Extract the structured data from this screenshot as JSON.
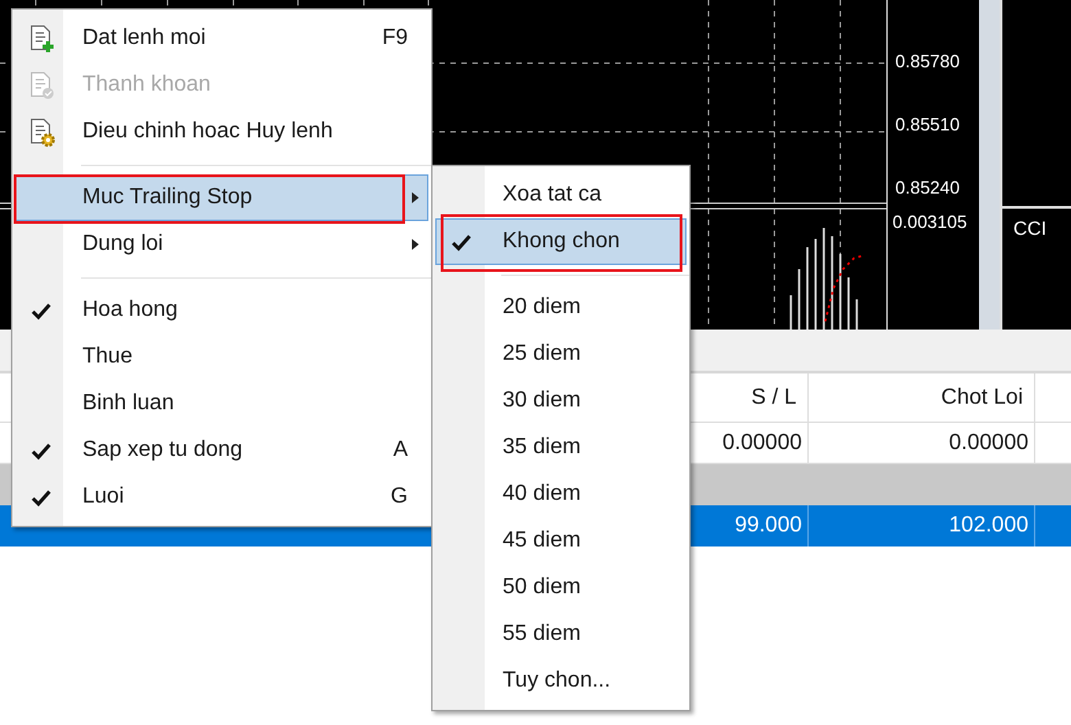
{
  "chart": {
    "price_labels": [
      "0.85780",
      "0.85510",
      "0.85240"
    ],
    "indicator_value": "0.003105",
    "side_label": "CCI"
  },
  "table": {
    "columns": [
      {
        "label": "S / L"
      },
      {
        "label": "Chot Loi"
      }
    ],
    "rows": [
      {
        "kind": "data",
        "selected": false,
        "cells": [
          "0.00000",
          "0.00000"
        ]
      },
      {
        "kind": "group"
      },
      {
        "kind": "data",
        "selected": true,
        "cells": [
          "99.000",
          "102.000"
        ]
      }
    ]
  },
  "context_menu": {
    "items": [
      {
        "kind": "icon-item",
        "label": "Dat lenh moi",
        "shortcut": "F9",
        "disabled": false,
        "checked": false,
        "selected": false,
        "has_submenu": false,
        "annotated": false
      },
      {
        "kind": "icon-item",
        "label": "Thanh khoan",
        "disabled": true,
        "checked": false,
        "selected": false,
        "has_submenu": false,
        "annotated": false
      },
      {
        "kind": "icon-item",
        "label": "Dieu chinh hoac Huy lenh",
        "disabled": false,
        "checked": false,
        "selected": false,
        "has_submenu": false,
        "annotated": false
      },
      {
        "kind": "separator"
      },
      {
        "kind": "item",
        "label": "Muc Trailing Stop",
        "disabled": false,
        "checked": false,
        "selected": true,
        "has_submenu": true,
        "annotated": true
      },
      {
        "kind": "item",
        "label": "Dung loi",
        "disabled": false,
        "checked": false,
        "selected": false,
        "has_submenu": true,
        "annotated": false
      },
      {
        "kind": "separator"
      },
      {
        "kind": "item",
        "label": "Hoa hong",
        "disabled": false,
        "checked": true,
        "selected": false,
        "has_submenu": false,
        "annotated": false
      },
      {
        "kind": "item",
        "label": "Thue",
        "disabled": false,
        "checked": false,
        "selected": false,
        "has_submenu": false,
        "annotated": false
      },
      {
        "kind": "item",
        "label": "Binh luan",
        "disabled": false,
        "checked": false,
        "selected": false,
        "has_submenu": false,
        "annotated": false
      },
      {
        "kind": "item",
        "label": "Sap xep tu dong",
        "shortcut": "A",
        "disabled": false,
        "checked": true,
        "selected": false,
        "has_submenu": false,
        "annotated": false
      },
      {
        "kind": "item",
        "label": "Luoi",
        "shortcut": "G",
        "disabled": false,
        "checked": true,
        "selected": false,
        "has_submenu": false,
        "annotated": false
      }
    ]
  },
  "submenu": {
    "items": [
      {
        "kind": "item",
        "label": "Xoa tat ca",
        "checked": false,
        "selected": false,
        "annotated": false
      },
      {
        "kind": "item",
        "label": "Khong chon",
        "checked": true,
        "selected": true,
        "annotated": true
      },
      {
        "kind": "separator"
      },
      {
        "kind": "item",
        "label": "20 diem",
        "checked": false,
        "selected": false,
        "annotated": false
      },
      {
        "kind": "item",
        "label": "25 diem",
        "checked": false,
        "selected": false,
        "annotated": false
      },
      {
        "kind": "item",
        "label": "30 diem",
        "checked": false,
        "selected": false,
        "annotated": false
      },
      {
        "kind": "item",
        "label": "35 diem",
        "checked": false,
        "selected": false,
        "annotated": false
      },
      {
        "kind": "item",
        "label": "40 diem",
        "checked": false,
        "selected": false,
        "annotated": false
      },
      {
        "kind": "item",
        "label": "45 diem",
        "checked": false,
        "selected": false,
        "annotated": false
      },
      {
        "kind": "item",
        "label": "50 diem",
        "checked": false,
        "selected": false,
        "annotated": false
      },
      {
        "kind": "item",
        "label": "55 diem",
        "checked": false,
        "selected": false,
        "annotated": false
      },
      {
        "kind": "item",
        "label": "Tuy chon...",
        "checked": false,
        "selected": false,
        "annotated": false
      }
    ]
  }
}
